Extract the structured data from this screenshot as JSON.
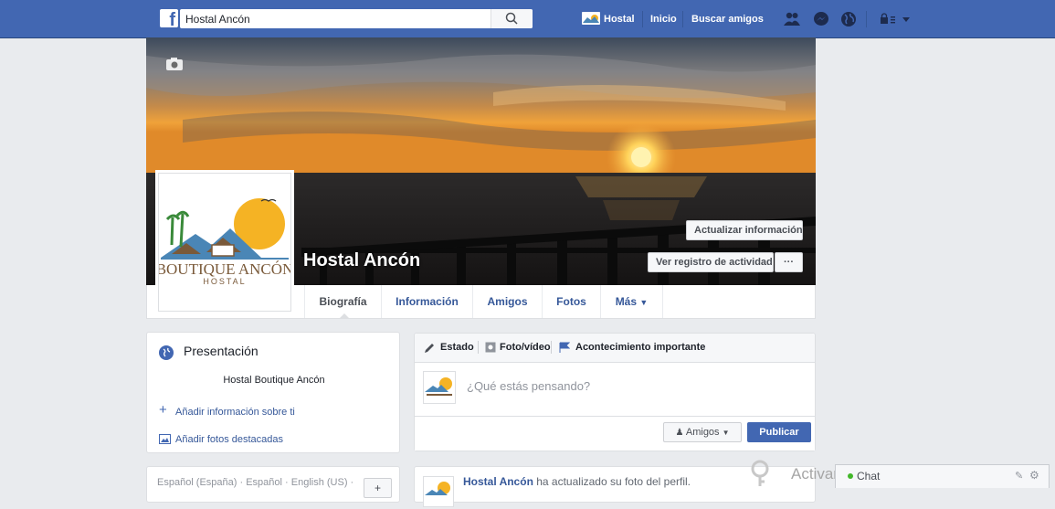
{
  "topbar": {
    "search_value": "Hostal Ancón",
    "profile_name": "Hostal",
    "links": [
      "Inicio",
      "Buscar amigos"
    ]
  },
  "cover": {
    "page_name": "Hostal Ancón",
    "update_info_button": "Actualizar información",
    "activity_log_button": "Ver registro de actividad",
    "more_button": "···"
  },
  "profile_logo": {
    "main": "BOUTIQUE ANCÓN",
    "sub": "HOSTAL"
  },
  "tabs": [
    "Biografía",
    "Información",
    "Amigos",
    "Fotos",
    "Más"
  ],
  "presentation": {
    "title": "Presentación",
    "description": "Hostal Boutique Ancón",
    "add_info": "Añadir información sobre ti",
    "add_photos": "Añadir fotos destacadas"
  },
  "language_bar": "Español (España) · Español · English (US) ·",
  "composer": {
    "tab_status": "Estado",
    "tab_photo": "Foto/vídeo",
    "tab_event": "Acontecimiento importante",
    "placeholder": "¿Qué estás pensando?",
    "audience": "Amigos",
    "publish": "Publicar"
  },
  "post": {
    "author": "Hostal Ancón",
    "text": " ha actualizado su foto del perfil."
  },
  "chat": {
    "label": "Chat"
  },
  "watermark": "Activar Windows",
  "colors": {
    "brand": "#4267b2",
    "link": "#365899",
    "background": "#e9ebee"
  }
}
